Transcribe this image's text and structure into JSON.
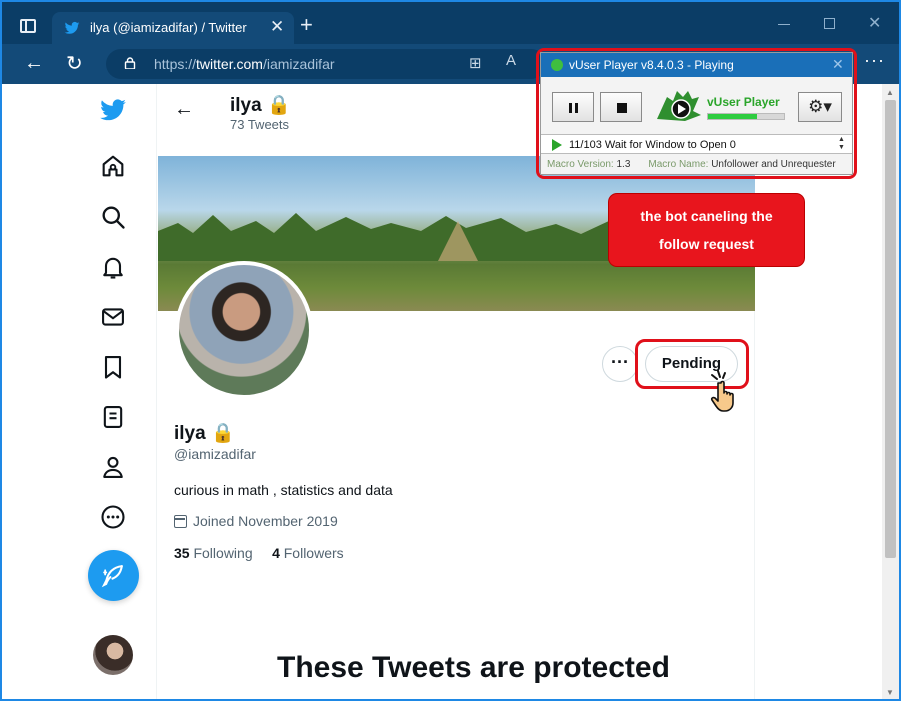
{
  "browser": {
    "tab_title": "ilya (@iamizadifar) / Twitter",
    "url_scheme": "https://",
    "url_host": "twitter.com",
    "url_path": "/iamizadifar"
  },
  "profile": {
    "header_name": "ilya",
    "tweet_count": "73 Tweets",
    "display_name": "ilya",
    "handle": "@iamizadifar",
    "bio": "curious in math , statistics and data",
    "joined": "Joined November 2019",
    "following_count": "35",
    "following_label": "Following",
    "followers_count": "4",
    "followers_label": "Followers",
    "pending_label": "Pending",
    "more_label": "···",
    "protected_title": "These Tweets are protected"
  },
  "nav": {
    "icons": [
      "twitter-logo-icon",
      "home-icon",
      "explore-icon",
      "notifications-icon",
      "messages-icon",
      "bookmarks-icon",
      "lists-icon",
      "profile-icon",
      "more-icon"
    ]
  },
  "vuser": {
    "title": "vUser Player v8.4.0.3 - Playing",
    "brand": "vUser Player",
    "progress": 0.64,
    "status": "11/103 Wait for Window to Open 0",
    "macro_version_label": "Macro Version:",
    "macro_version": "1.3",
    "macro_name_label": "Macro Name:",
    "macro_name": "Unfollower and Unrequester"
  },
  "annotation": {
    "line1": "the bot caneling the",
    "line2": "follow request"
  },
  "colors": {
    "twitter_blue": "#1d9bf0",
    "highlight_red": "#e0101a",
    "browser_dark": "#0b3d66"
  }
}
